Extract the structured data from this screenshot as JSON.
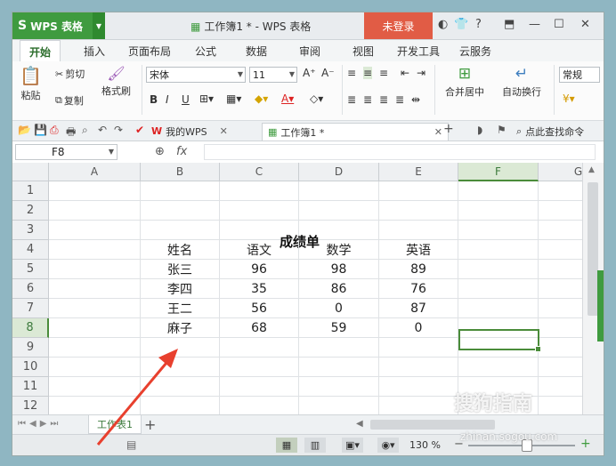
{
  "app": {
    "name": "WPS 表格",
    "doc_title": "工作簿1 * - WPS 表格",
    "login_label": "未登录"
  },
  "ribbon_tabs": [
    "开始",
    "插入",
    "页面布局",
    "公式",
    "数据",
    "审阅",
    "视图",
    "开发工具",
    "云服务"
  ],
  "ribbon": {
    "paste": "粘贴",
    "cut": "剪切",
    "copy": "复制",
    "format_painter": "格式刷",
    "font_name": "宋体",
    "font_size": "11",
    "merge_center": "合并居中",
    "wrap_text": "自动换行",
    "number_format": "常规"
  },
  "doc_tabs": {
    "my_wps": "我的WPS",
    "workbook": "工作簿1 *",
    "search": "点此查找命令"
  },
  "formula_bar": {
    "name_box": "F8",
    "fx": "fx",
    "value": ""
  },
  "columns": [
    "A",
    "B",
    "C",
    "D",
    "E",
    "F",
    "G"
  ],
  "rows": [
    "1",
    "2",
    "3",
    "4",
    "5",
    "6",
    "7",
    "8",
    "9",
    "10",
    "11",
    "12"
  ],
  "sheet": {
    "title": "成绩单",
    "headers": [
      "姓名",
      "语文",
      "数学",
      "英语"
    ],
    "records": [
      [
        "张三",
        "96",
        "98",
        "89"
      ],
      [
        "李四",
        "35",
        "86",
        "76"
      ],
      [
        "王二",
        "56",
        "0",
        "87"
      ],
      [
        "麻子",
        "68",
        "59",
        "0"
      ]
    ]
  },
  "sheet_tab": "工作表1",
  "status": {
    "zoom": "130 %"
  },
  "watermark": {
    "brand": "搜狗指南",
    "url": "zhinan.sogou.com"
  },
  "colors": {
    "accent": "#3f9b3f",
    "login": "#e15c45",
    "selection": "#4a8c3a",
    "arrow": "#e8402e"
  }
}
